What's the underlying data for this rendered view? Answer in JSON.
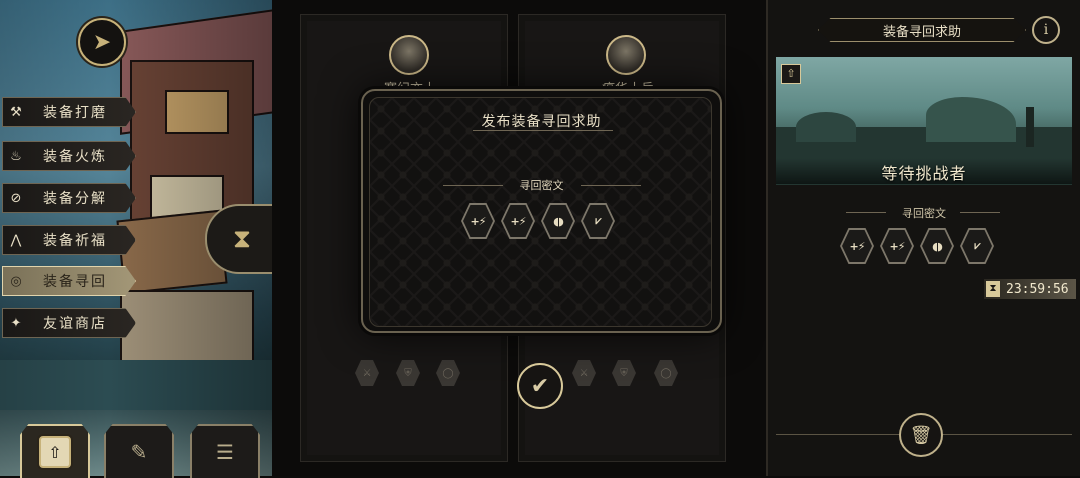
{
  "left_menu": {
    "items": [
      {
        "label": "装备打磨",
        "icon": "hammer-icon",
        "glyph": "⚒"
      },
      {
        "label": "装备火炼",
        "icon": "flame-icon",
        "glyph": "♨"
      },
      {
        "label": "装备分解",
        "icon": "disassemble-icon",
        "glyph": "⊘"
      },
      {
        "label": "装备祈福",
        "icon": "pray-icon",
        "glyph": "⋀"
      },
      {
        "label": "装备寻回",
        "icon": "recover-icon",
        "glyph": "◎"
      },
      {
        "label": "友谊商店",
        "icon": "fox-icon",
        "glyph": "✦"
      }
    ],
    "active_index": 4
  },
  "bottom_tabs": [
    {
      "icon": "upload-icon",
      "glyph": "⇧"
    },
    {
      "icon": "feather-icon",
      "glyph": "✎"
    },
    {
      "icon": "list-icon",
      "glyph": "☰"
    }
  ],
  "cards": {
    "left_name": "赛纪亦土",
    "right_name": "癌华十岳"
  },
  "modal": {
    "title": "发布装备寻回求助",
    "cipher_label": "寻回密文",
    "runes": [
      "+⚡",
      "+⚡",
      "◖◗",
      "⩗"
    ]
  },
  "confirm_button": {
    "glyph": "✔"
  },
  "right_panel": {
    "title": "装备寻回求助",
    "info_glyph": "i",
    "status": "等待挑战者",
    "cipher_label": "寻回密文",
    "runes": [
      "+⚡",
      "+⚡",
      "◖◗",
      "⩗"
    ],
    "timer": "23:59:56",
    "trash_glyph": "🗑"
  },
  "colors": {
    "accent_gold": "#c7b27a",
    "panel_dark": "#141311",
    "active_menu": "#a39777"
  }
}
